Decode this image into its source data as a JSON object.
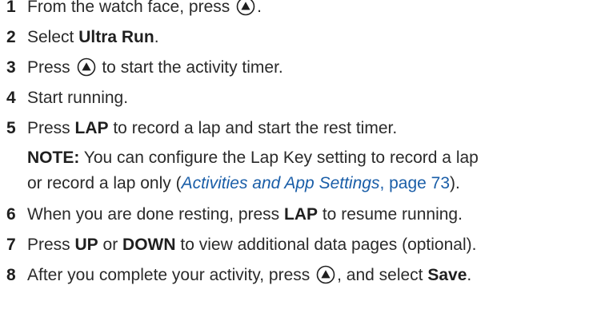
{
  "steps": [
    {
      "num": "1",
      "before": "From the watch face, press ",
      "after": "."
    },
    {
      "num": "2",
      "before": "Select ",
      "bold": "Ultra Run",
      "after": "."
    },
    {
      "num": "3",
      "before": "Press ",
      "after": " to start the activity timer."
    },
    {
      "num": "4",
      "text": "Start running."
    },
    {
      "num": "5",
      "before": "Press ",
      "bold": "LAP",
      "after": " to record a lap and start the rest timer."
    },
    {
      "num": "6",
      "before": "When you are done resting, press ",
      "bold": "LAP",
      "after": " to resume running."
    },
    {
      "num": "7",
      "before": "Press ",
      "bold1": "UP",
      "mid": " or ",
      "bold2": "DOWN",
      "after": " to view additional data pages (optional)."
    },
    {
      "num": "8",
      "before": "After you complete your activity, press ",
      "mid": ", and select ",
      "bold": "Save",
      "after": "."
    }
  ],
  "note": {
    "label": "NOTE:",
    "line1": " You can configure the Lap Key setting to record a lap",
    "line2_before": "or record a lap only (",
    "link_text": "Activities and App Settings",
    "link_page": ", page 73",
    "line2_after": ")."
  },
  "icons": {
    "start_button": "start-stop-button-icon"
  }
}
